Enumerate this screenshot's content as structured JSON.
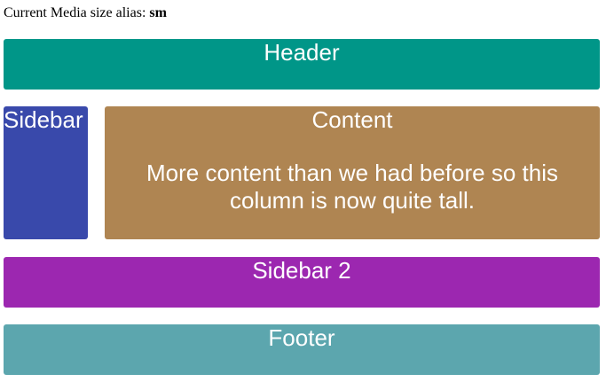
{
  "media": {
    "label": "Current Media size alias:",
    "alias": "sm"
  },
  "header": {
    "title": "Header",
    "color": "#009688"
  },
  "sidebar": {
    "title": "Sidebar",
    "color": "#3949AB"
  },
  "content": {
    "title": "Content",
    "body": "More content than we had before so this column is now quite tall.",
    "color": "#AF8552"
  },
  "sidebar2": {
    "title": "Sidebar 2",
    "color": "#9C27B0"
  },
  "footer": {
    "title": "Footer",
    "color": "#5CA6AE"
  }
}
